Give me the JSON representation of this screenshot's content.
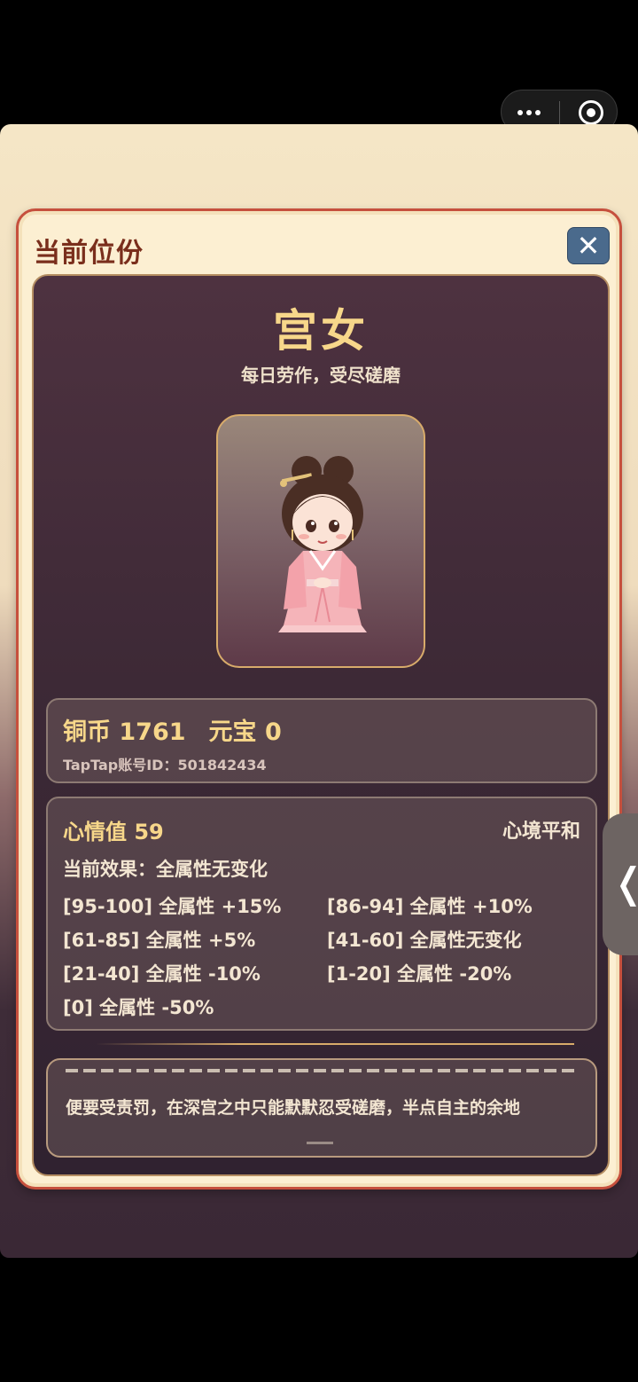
{
  "system": {
    "more_icon": "more-dots-icon",
    "close_app_icon": "target-circle-icon"
  },
  "modal": {
    "title": "当前位份",
    "close_glyph": "✕"
  },
  "rank": {
    "name": "宫女",
    "description": "每日劳作，受尽磋磨",
    "portrait": "palace-maid-portrait"
  },
  "wallet": {
    "copper": "铜币 1761",
    "ingot": "元宝 0",
    "account": "TapTap账号ID：501842434"
  },
  "mood": {
    "title": "心情值 59",
    "state": "心境平和",
    "current_effect": "当前效果：全属性无变化",
    "tiers": [
      "[95-100] 全属性 +15%",
      "[86-94] 全属性 +10%",
      "[61-85] 全属性 +5%",
      "[41-60] 全属性无变化",
      "[21-40] 全属性 -10%",
      "[1-20] 全属性 -20%",
      "[0] 全属性 -50%"
    ]
  },
  "story": {
    "visible_line": "便要受责罚，在深宫之中只能默默忍受磋磨，半点自主的余地"
  },
  "side_tab": {
    "glyph": "❬"
  },
  "colors": {
    "accent_gold": "#f7d78a",
    "modal_border": "#c6503d",
    "close_button": "#4a6a8c",
    "panel_bg": "#3d2936"
  }
}
